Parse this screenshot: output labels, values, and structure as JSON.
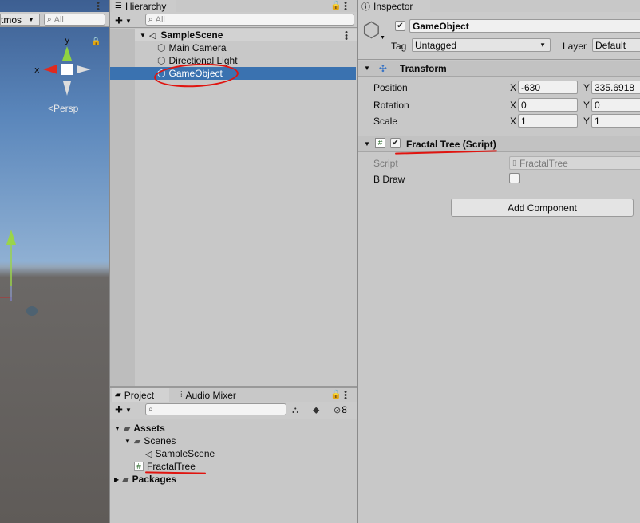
{
  "scene": {
    "gizmos_label": "tmos",
    "search_placeholder": "All",
    "axis_y": "y",
    "axis_x": "x",
    "persp_label": "<Persp"
  },
  "hierarchy": {
    "tab_label": "Hierarchy",
    "add_label": "+",
    "search_placeholder": "All",
    "scene_name": "SampleScene",
    "items": [
      "Main Camera",
      "Directional Light",
      "GameObject"
    ]
  },
  "inspector": {
    "tab_label": "Inspector",
    "object_name": "GameObject",
    "tag_label": "Tag",
    "tag_value": "Untagged",
    "layer_label": "Layer",
    "layer_value": "Default",
    "transform": {
      "title": "Transform",
      "position_label": "Position",
      "rotation_label": "Rotation",
      "scale_label": "Scale",
      "x_label": "X",
      "y_label": "Y",
      "position_x": "-630",
      "position_y": "335.6918",
      "rotation_x": "0",
      "rotation_y": "0",
      "scale_x": "1",
      "scale_y": "1"
    },
    "script_component": {
      "title": "Fractal Tree (Script)",
      "script_label": "Script",
      "script_value": "FractalTree",
      "bdraw_label": "B Draw",
      "bdraw_checked": false
    },
    "add_component_label": "Add Component"
  },
  "project": {
    "tab_label": "Project",
    "audio_mixer_label": "Audio Mixer",
    "add_label": "+",
    "hidden_count": "8",
    "tree": {
      "assets": "Assets",
      "scenes": "Scenes",
      "sample_scene": "SampleScene",
      "fractal_tree": "FractalTree",
      "packages": "Packages"
    }
  },
  "colors": {
    "selection": "#3a72b0",
    "annotation": "#e0140f",
    "sky": "#5a86bb",
    "ground": "#5f5b58"
  }
}
